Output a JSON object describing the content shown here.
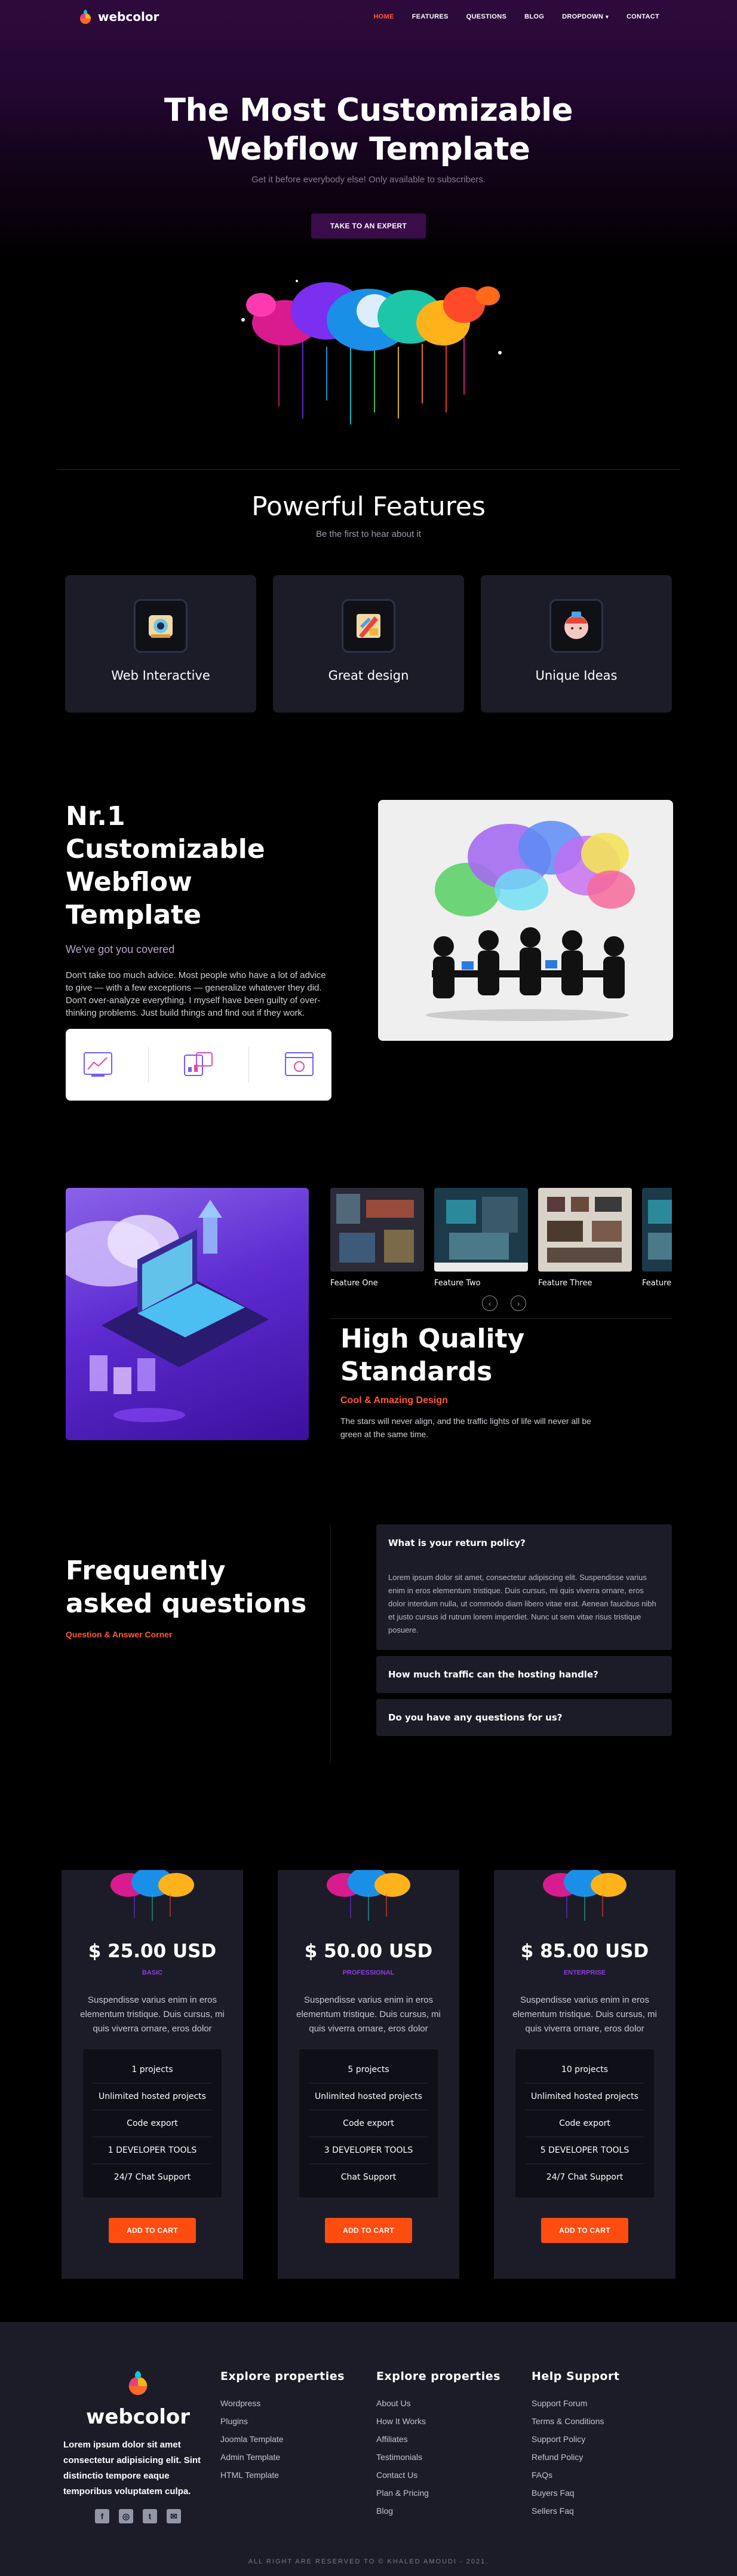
{
  "nav": {
    "brand": "webcolor",
    "items": [
      {
        "label": "HOME",
        "active": true
      },
      {
        "label": "FEATURES"
      },
      {
        "label": "QUESTIONS"
      },
      {
        "label": "BLOG"
      },
      {
        "label": "DROPDOWN"
      },
      {
        "label": "CONTACT"
      }
    ]
  },
  "hero": {
    "title": "The Most Customizable Webflow Template",
    "subtitle": "Get it before everybody else! Only available to subscribers.",
    "button": "TAKE TO AN EXPERT"
  },
  "features": {
    "title": "Powerful Features",
    "subtitle": "Be the first to hear about it",
    "cards": [
      {
        "label": "Web Interactive",
        "icon": "robot-icon"
      },
      {
        "label": "Great design",
        "icon": "design-tools-icon"
      },
      {
        "label": "Unique Ideas",
        "icon": "idea-head-icon"
      }
    ]
  },
  "customizable": {
    "title": "Nr.1 Customizable Webflow Template",
    "tagline": "We've got you covered",
    "body": "Don't take too much advice. Most people who have a lot of advice to give — with a few exceptions — generalize whatever they did. Don't over-analyze everything. I myself have been guilty of over-thinking problems. Just build things and find out if they work."
  },
  "quality": {
    "slides": [
      "Feature One",
      "Feature Two",
      "Feature Three",
      "Feature Four"
    ],
    "title": "High Quality Standards",
    "tagline": "Cool & Amazing Design",
    "body": "The stars will never align, and the traffic lights of life will never all be green at the same time."
  },
  "faq": {
    "title": "Frequently asked questions",
    "tagline": "Question & Answer Corner",
    "items": [
      {
        "q": "What is your return policy?",
        "a": "Lorem ipsum dolor sit amet, consectetur adipiscing elit. Suspendisse varius enim in eros elementum tristique. Duis cursus, mi quis viverra ornare, eros dolor interdum nulla, ut commodo diam libero vitae erat. Aenean faucibus nibh et justo cursus id rutrum lorem imperdiet. Nunc ut sem vitae risus tristique posuere."
      },
      {
        "q": "How much traffic can the hosting handle?",
        "a": ""
      },
      {
        "q": "Do you have any questions for us?",
        "a": ""
      }
    ]
  },
  "pricing": {
    "desc": "Suspendisse varius enim in eros elementum tristique. Duis cursus, mi quis viverra ornare, eros dolor",
    "button": "ADD TO CART",
    "plans": [
      {
        "price": "$ 25.00 USD",
        "tier": "BASIC",
        "features": [
          "1 projects",
          "Unlimited hosted projects",
          "Code export",
          "1 DEVELOPER TOOLS",
          "24/7 Chat Support"
        ]
      },
      {
        "price": "$ 50.00 USD",
        "tier": "PROFESSIONAL",
        "features": [
          "5 projects",
          "Unlimited hosted projects",
          "Code export",
          "3 DEVELOPER TOOLS",
          "Chat Support"
        ]
      },
      {
        "price": "$ 85.00 USD",
        "tier": "ENTERPRISE",
        "features": [
          "10 projects",
          "Unlimited hosted projects",
          "Code export",
          "5 DEVELOPER TOOLS",
          "24/7 Chat Support"
        ]
      }
    ]
  },
  "footer": {
    "brand": "webcolor",
    "blurb": "Lorem ipsum dolor sit amet consectetur adipisicing elit. Sint distinctio tempore eaque temporibus voluptatem culpa.",
    "social": [
      "facebook-icon",
      "instagram-icon",
      "twitter-icon",
      "mail-icon"
    ],
    "columns": [
      {
        "title": "Explore properties",
        "links": [
          "Wordpress",
          "Plugins",
          "Joomla Template",
          "Admin Template",
          "HTML Template"
        ]
      },
      {
        "title": "Explore properties",
        "links": [
          "About Us",
          "How It Works",
          "Affiliates",
          "Testimonials",
          "Contact Us",
          "Plan & Pricing",
          "Blog"
        ]
      },
      {
        "title": "Help Support",
        "links": [
          "Support Forum",
          "Terms & Conditions",
          "Support Policy",
          "Refund Policy",
          "FAQs",
          "Buyers Faq",
          "Sellers Faq"
        ]
      }
    ],
    "copyright": "ALL RIGHT ARE RESERVED TO © KHALED AMOUDI - 2021."
  },
  "colors": {
    "accent": "#ff5a36",
    "card": "#1c1c28",
    "purple": "#8b3fd6",
    "cart": "#ff4c10"
  }
}
